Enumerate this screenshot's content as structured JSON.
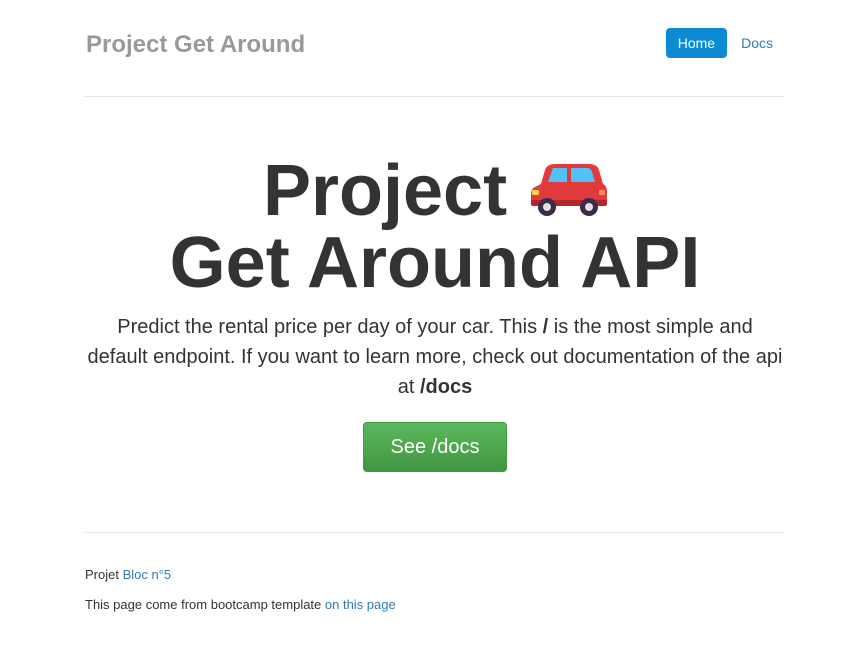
{
  "header": {
    "brand": "Project Get Around",
    "nav": {
      "home_label": "Home",
      "docs_label": "Docs"
    }
  },
  "hero": {
    "title_line1": "Project",
    "title_line2": "Get Around API",
    "title_icon": "red-car-icon",
    "lead_part1": "Predict the rental price per day of your car. This ",
    "lead_bold1": "/",
    "lead_part2": " is the most simple and default endpoint. If you want to learn more, check out documentation of the api at ",
    "lead_bold2": "/docs",
    "cta_label": "See /docs"
  },
  "footer": {
    "line1_prefix": "Projet ",
    "line1_link": "Bloc n°5",
    "line2_prefix": "This page come from bootcamp template ",
    "line2_link": "on this page"
  },
  "colors": {
    "accent": "#0c8ad4",
    "link": "#337ab7",
    "button_green": "#5cb85c",
    "brand_gray": "#999999"
  }
}
